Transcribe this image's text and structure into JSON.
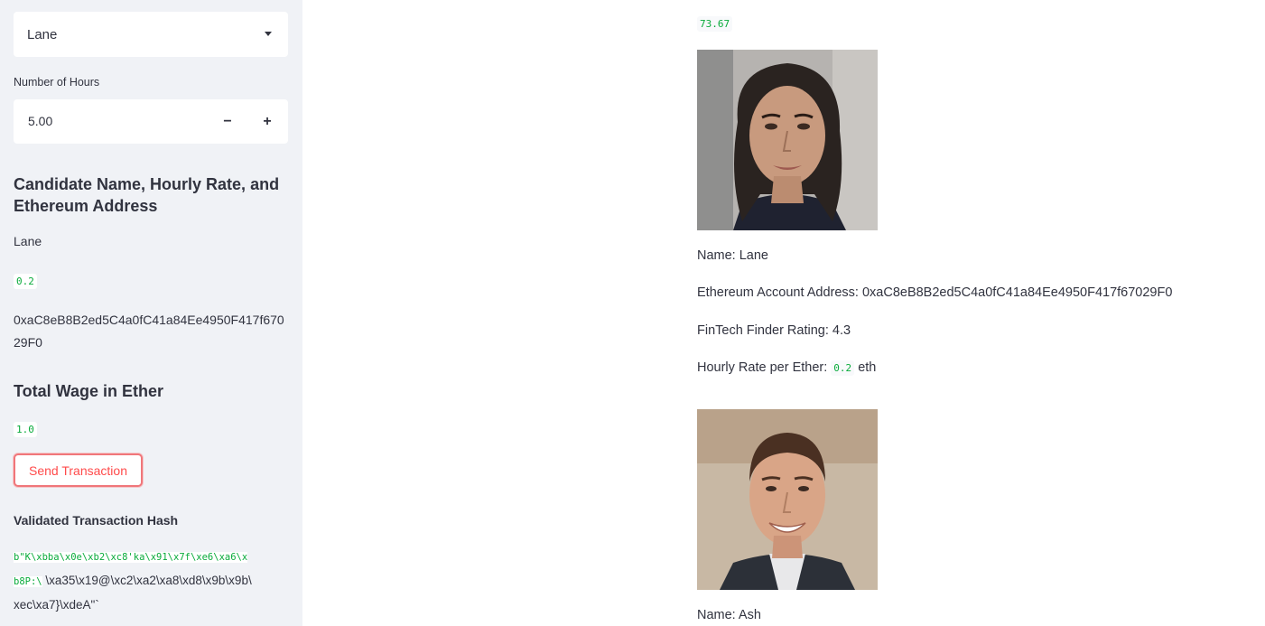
{
  "sidebar": {
    "candidate_select": {
      "value": "Lane"
    },
    "hours": {
      "label": "Number of Hours",
      "value": "5.00",
      "decrement": "−",
      "increment": "+"
    },
    "candidate_header": "Candidate Name, Hourly Rate, and Ethereum Address",
    "candidate_name": "Lane",
    "candidate_rate": "0.2",
    "candidate_address": "0xaC8eB8B2ed5C4a0fC41a84Ee4950F417f67029F0",
    "total_wage_header": "Total Wage in Ether",
    "total_wage": "1.0",
    "send_button": "Send Transaction",
    "hash_header": "Validated Transaction Hash",
    "hash_code_1": "b\"K\\xbba\\x0e\\xb2\\xc8'ka\\x91\\x7f\\xe6\\xa6\\x",
    "hash_code_2": "b8P:\\",
    "hash_text_2": " \\xa35\\x19@\\xc2\\xa2\\xa8\\xd8\\x9b\\x9b\\",
    "hash_text_3": "xec\\xa7}\\xdeA\"`"
  },
  "main": {
    "balance": "73.67",
    "candidates": [
      {
        "name_line": "Name: Lane",
        "address_line": "Ethereum Account Address: 0xaC8eB8B2ed5C4a0fC41a84Ee4950F417f67029F0",
        "rating_line": "FinTech Finder Rating: 4.3",
        "rate_prefix": "Hourly Rate per Ether: ",
        "rate_value": "0.2",
        "rate_suffix": " eth"
      },
      {
        "name_line": "Name: Ash"
      }
    ]
  },
  "colors": {
    "sidebar_bg": "#f0f2f6",
    "code_green": "#09ab3b",
    "accent_red": "#ff4b4b"
  }
}
